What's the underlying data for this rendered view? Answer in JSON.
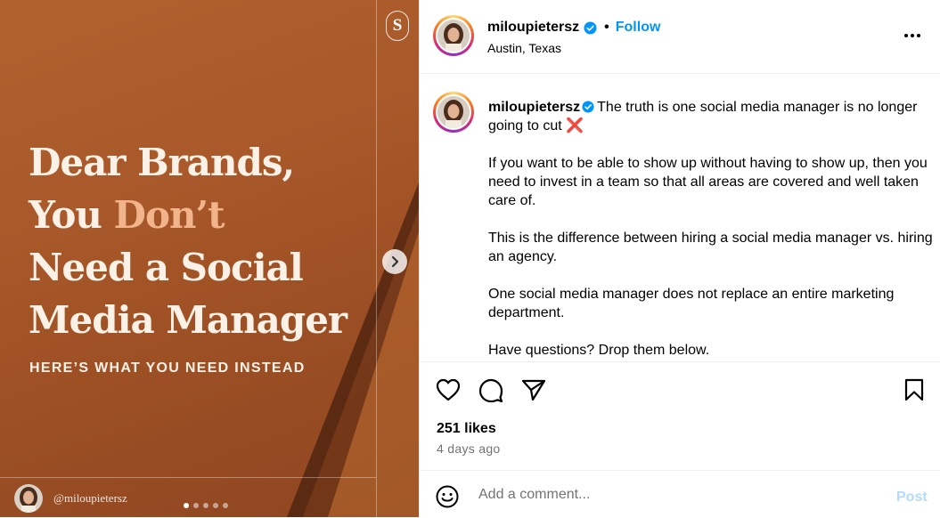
{
  "media": {
    "brand_mark": "S",
    "headline": {
      "line1": "Dear Brands,",
      "line2_start": "You ",
      "line2_accent": "Don’t",
      "line3": "Need a Social",
      "line4": "Media Manager"
    },
    "subheadline": "HERE’S WHAT YOU NEED INSTEAD",
    "creator_handle": "@miloupietersz",
    "carousel": {
      "count": 5,
      "current": 1
    },
    "colors": {
      "background": "#a9592a",
      "headline": "#fbf1e6",
      "accent": "#f2b48a"
    }
  },
  "header": {
    "username": "miloupietersz",
    "separator": "•",
    "follow_label": "Follow",
    "location": "Austin, Texas"
  },
  "caption": {
    "username": "miloupietersz",
    "p1": "The truth is one social media manager is no longer going to cut",
    "p1_emoji": "❌",
    "p2": "If you want to be able to show up without having to show up, then you need to invest in a team so that all areas are covered and well taken care of.",
    "p3": "This is the difference between hiring a social media manager vs. hiring an agency.",
    "p4": "One social media manager does not replace an entire marketing department.",
    "p5": "Have questions? Drop them below."
  },
  "stats": {
    "likes": "251 likes",
    "posted": "4 days ago"
  },
  "comment": {
    "placeholder": "Add a comment...",
    "post_label": "Post"
  },
  "icons": [
    "s-logo-icon",
    "chevron-right-icon",
    "verified-badge-icon",
    "more-icon",
    "heart-icon",
    "comment-icon",
    "share-icon",
    "bookmark-icon",
    "emoji-icon"
  ],
  "colors": {
    "link": "#0095f6",
    "post_disabled": "#b3dbff",
    "muted": "#737373"
  }
}
